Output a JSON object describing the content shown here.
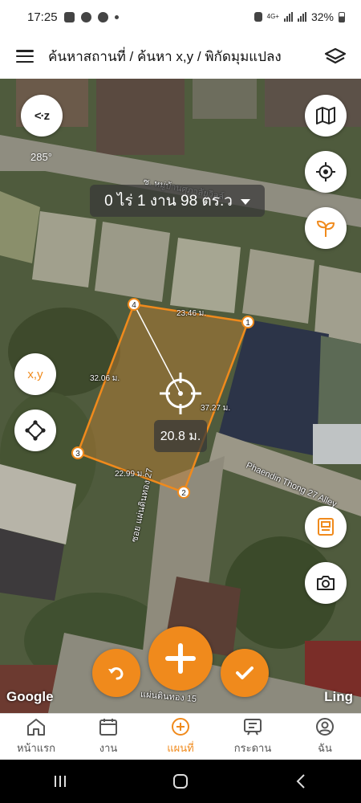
{
  "status_bar": {
    "time": "17:25",
    "network": "4G+",
    "battery": "32%"
  },
  "header": {
    "title": "ค้นหาสถานที่ / ค้นหา x,y / พิกัดมุมแปลง"
  },
  "map": {
    "area_text": "0 ไร่ 1 งาน 98 ตร.ว",
    "compass_label": "<·z",
    "heading": "285°",
    "xy_button_label": "x,y",
    "center_distance": "20.8 ม.",
    "road_labels": [
      "ซ. หมู่บ้านศุภาลัยวิลล์",
      "Phaendin Thong 27 Alley",
      "ซอย แผ่นดินทอง 27",
      "แผ่นดินทอง 15"
    ],
    "vertices": [
      "1",
      "2",
      "3",
      "4"
    ],
    "segments": [
      "23.46 ม.",
      "37.27 ม.",
      "22.99 ม.",
      "32.06 ม."
    ],
    "attribution_left": "Google",
    "attribution_right": "Ling",
    "accent": "#f08a1c"
  },
  "bottom_nav": {
    "items": [
      {
        "label": "หน้าแรก",
        "icon": "home-icon"
      },
      {
        "label": "งาน",
        "icon": "calendar-icon"
      },
      {
        "label": "แผนที่",
        "icon": "plus-circle-icon"
      },
      {
        "label": "กระดาน",
        "icon": "board-icon"
      },
      {
        "label": "ฉัน",
        "icon": "user-icon"
      }
    ],
    "active_index": 2
  }
}
